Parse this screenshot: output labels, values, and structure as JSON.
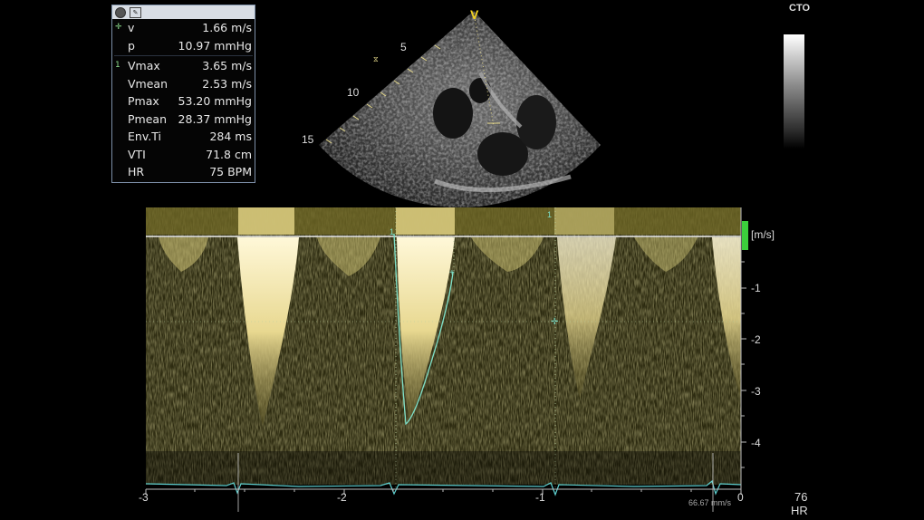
{
  "measurements": {
    "cursor_rows": [
      {
        "label": "v",
        "value": "1.66 m/s"
      },
      {
        "label": "p",
        "value": "10.97 mmHg"
      }
    ],
    "trace_marker": "1",
    "trace_rows": [
      {
        "label": "Vmax",
        "value": "3.65 m/s"
      },
      {
        "label": "Vmean",
        "value": "2.53 m/s"
      },
      {
        "label": "Pmax",
        "value": "53.20 mmHg"
      },
      {
        "label": "Pmean",
        "value": "28.37 mmHg"
      },
      {
        "label": "Env.Ti",
        "value": "284 ms"
      },
      {
        "label": "VTI",
        "value": "71.8 cm"
      },
      {
        "label": "HR",
        "value": "75 BPM"
      }
    ]
  },
  "sector": {
    "orientation_marker": "V",
    "depth_labels": [
      "5",
      "10",
      "15"
    ]
  },
  "gray_map": {
    "label": "CTO"
  },
  "doppler": {
    "velocity_unit": "[m/s]",
    "velocity_ticks": [
      "-1",
      "-2",
      "-3",
      "-4"
    ],
    "time_ticks": [
      "-3",
      "-2",
      "-1",
      "0"
    ],
    "sweep_speed": "66.67 mm/s",
    "trace_markers": [
      "1",
      "1"
    ],
    "heart_rate": "76",
    "heart_rate_label": "HR"
  },
  "colors": {
    "spectral": "#e6d98a",
    "trace": "#7fe0c8",
    "ecg": "#5ed0d0",
    "range_gate": "#3ccf3c"
  }
}
